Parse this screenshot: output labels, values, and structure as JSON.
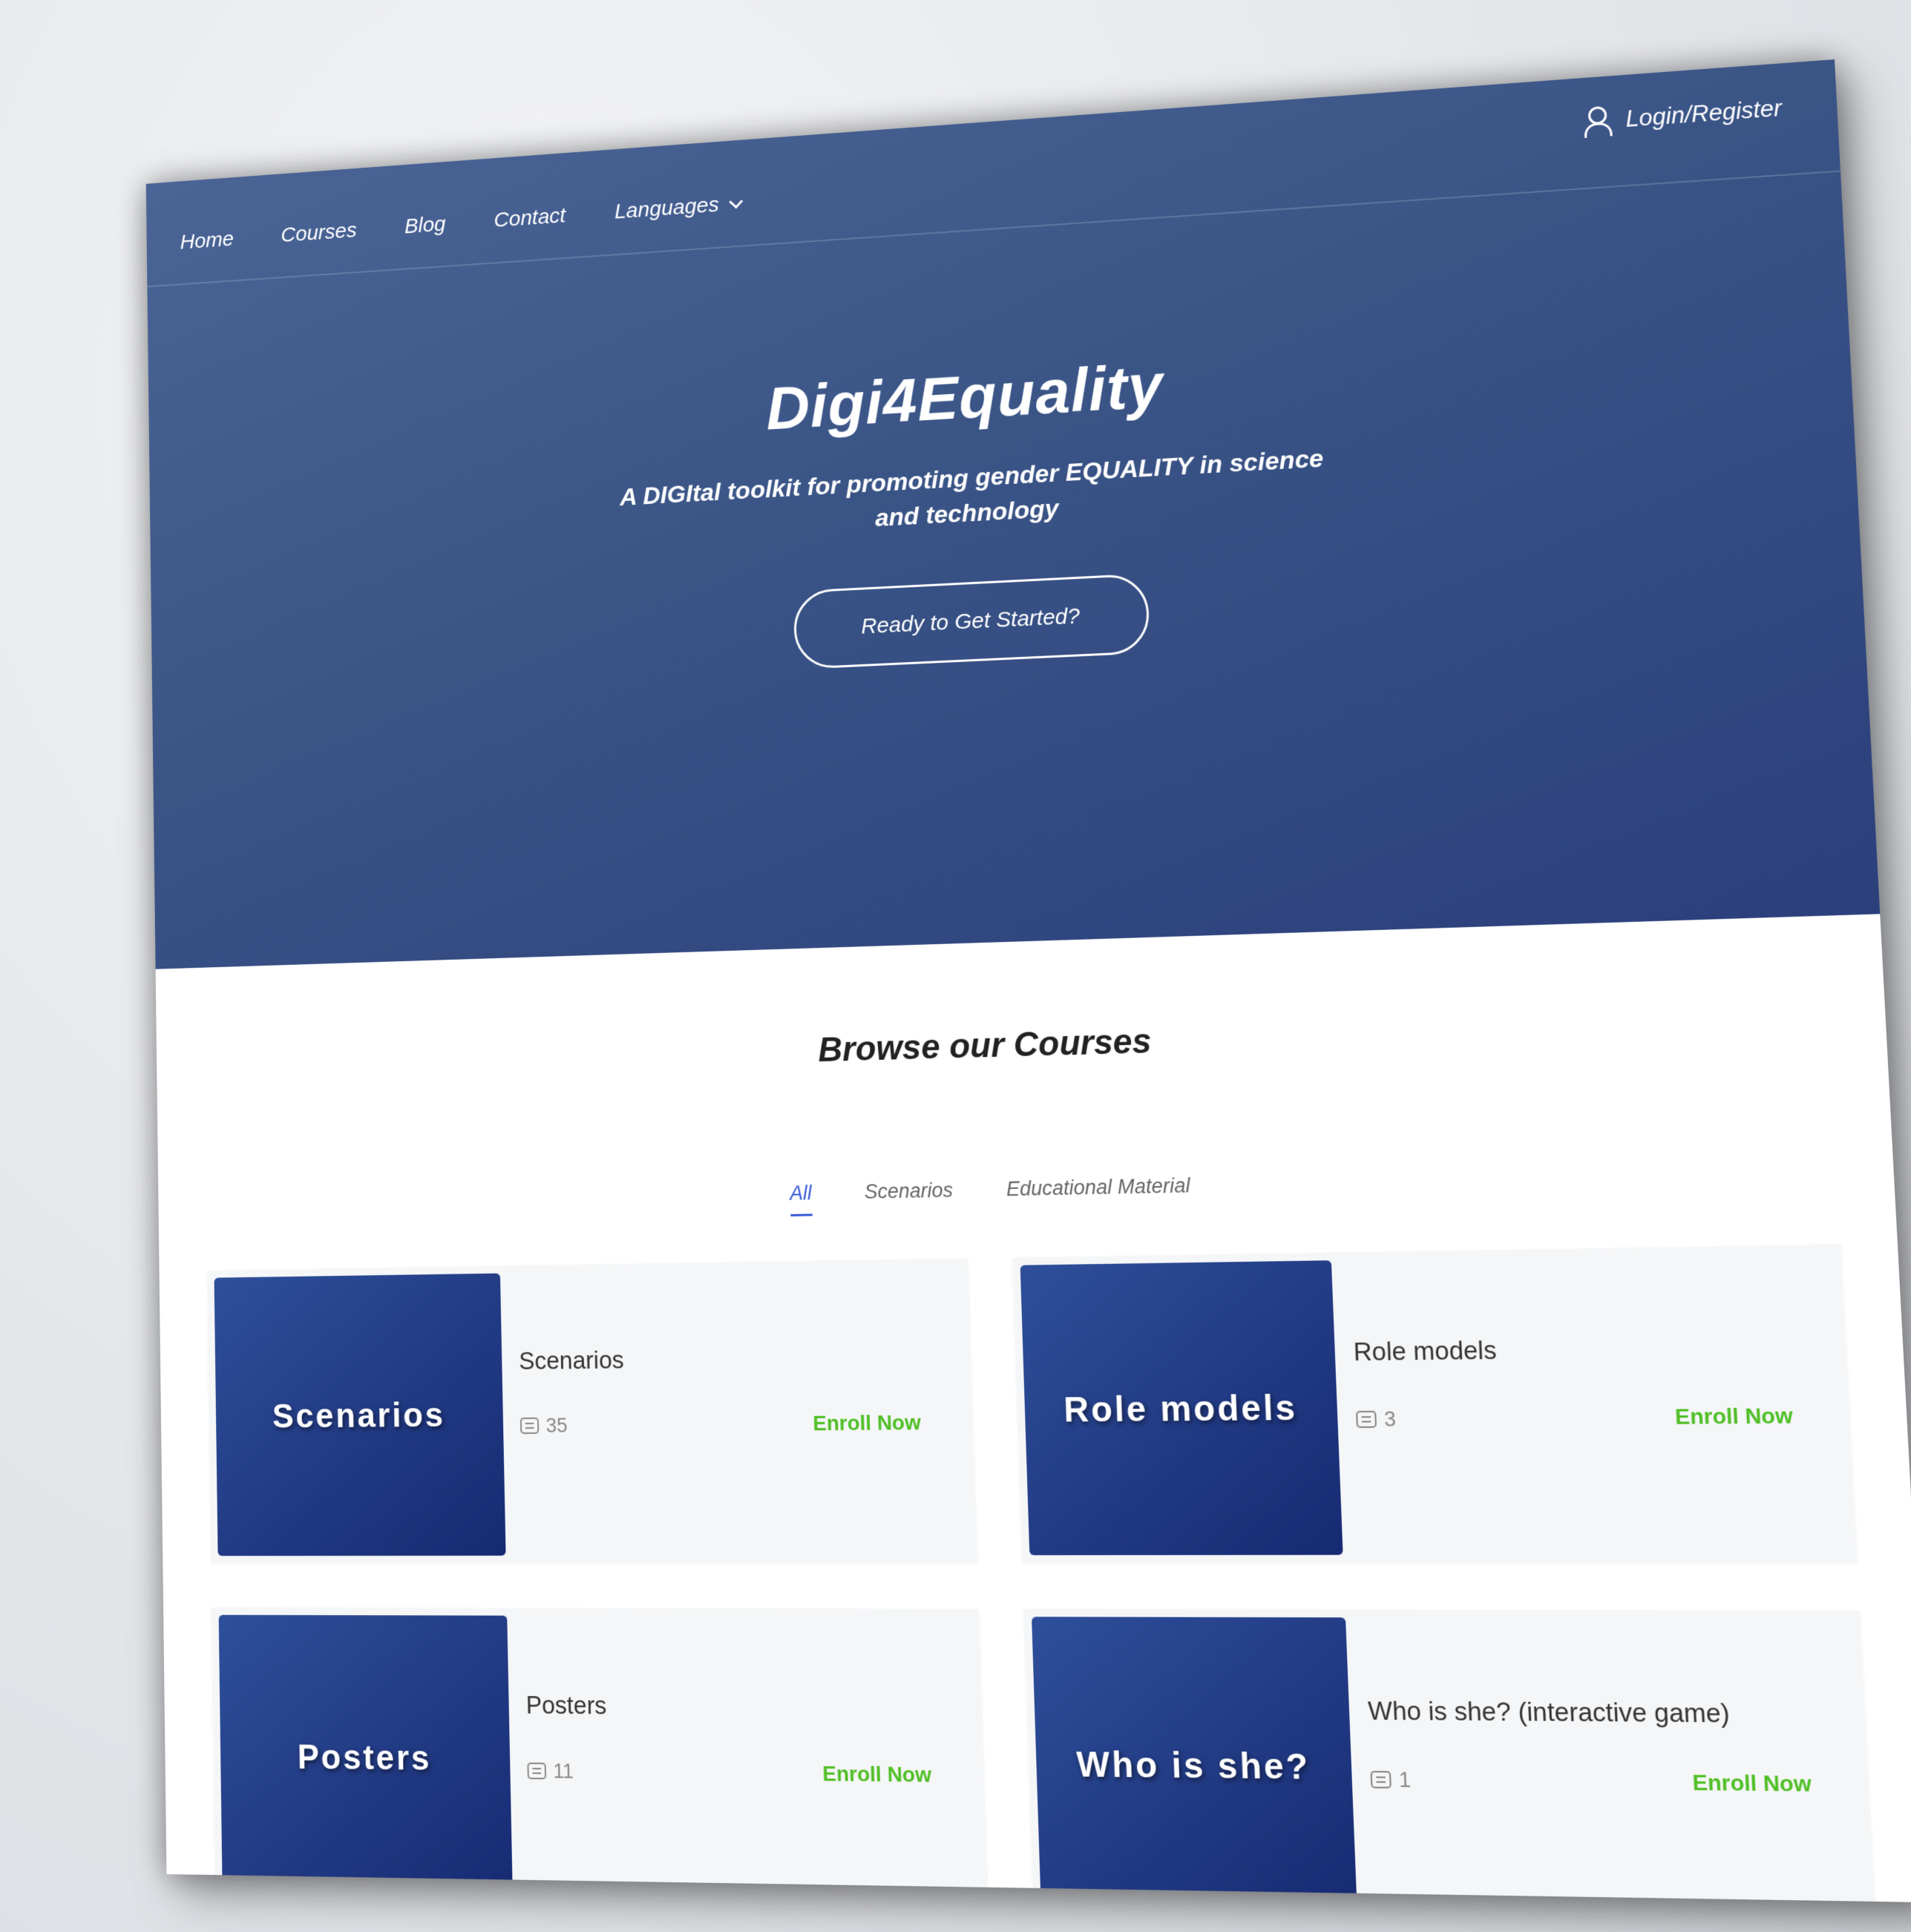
{
  "nav": {
    "items": [
      "Home",
      "Courses",
      "Blog",
      "Contact"
    ],
    "languages_label": "Languages",
    "login_label": "Login/Register"
  },
  "hero": {
    "title": "Digi4Equality",
    "subtitle": "A DIGItal toolkit for promoting gender EQUALITY in science and technology",
    "cta_label": "Ready to Get Started?"
  },
  "browse": {
    "title": "Browse our Courses",
    "filters": [
      "All",
      "Scenarios",
      "Educational Material"
    ],
    "active_filter": "All"
  },
  "courses": [
    {
      "thumb_text": "Scenarios",
      "title": "Scenarios",
      "count": "35",
      "enroll_label": "Enroll Now"
    },
    {
      "thumb_text": "Role models",
      "title": "Role models",
      "count": "3",
      "enroll_label": "Enroll Now"
    },
    {
      "thumb_text": "Posters",
      "title": "Posters",
      "count": "11",
      "enroll_label": "Enroll Now"
    },
    {
      "thumb_text": "Who is she?",
      "title": "Who is she? (interactive game)",
      "count": "1",
      "enroll_label": "Enroll Now"
    }
  ],
  "colors": {
    "hero_bg": "#3a5486",
    "thumb_bg": "#233c86",
    "accent_blue": "#3a5bd9",
    "enroll_green": "#4fbf26"
  }
}
